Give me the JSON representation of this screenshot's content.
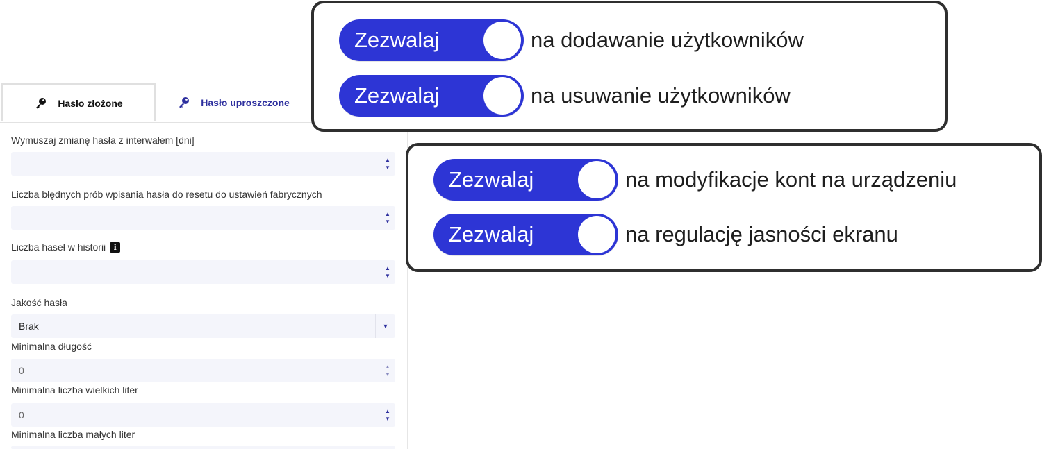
{
  "tabs": {
    "complex": "Hasło złożone",
    "simple": "Hasło uproszczone"
  },
  "fields": {
    "interval_label": "Wymuszaj zmianę hasła z interwałem [dni]",
    "interval_value": "",
    "failed_attempts_label": "Liczba błędnych prób wpisania hasła do resetu do ustawień fabrycznych",
    "failed_attempts_value": "",
    "history_label": "Liczba haseł w historii",
    "history_info": "i",
    "history_value": "",
    "quality_label": "Jakość hasła",
    "quality_value": "Brak",
    "min_length_label": "Minimalna długość",
    "min_length_value": "0",
    "min_upper_label": "Minimalna liczba wielkich liter",
    "min_upper_value": "0",
    "min_lower_label": "Minimalna liczba małych liter"
  },
  "callout_top": {
    "toggles": [
      {
        "label": "Zezwalaj",
        "text": "na dodawanie użytkowników",
        "on": true
      },
      {
        "label": "Zezwalaj",
        "text": "na usuwanie użytkowników",
        "on": true
      }
    ]
  },
  "callout_bottom": {
    "toggles": [
      {
        "label": "Zezwalaj",
        "text": "na modyfikacje kont na urządzeniu",
        "on": true
      },
      {
        "label": "Zezwalaj",
        "text": "na regulację jasności ekranu",
        "on": true
      }
    ]
  },
  "colors": {
    "toggle_on": "#2d35d5",
    "accent_text": "#2d2f9e",
    "callout_border": "#2f2f2f"
  }
}
